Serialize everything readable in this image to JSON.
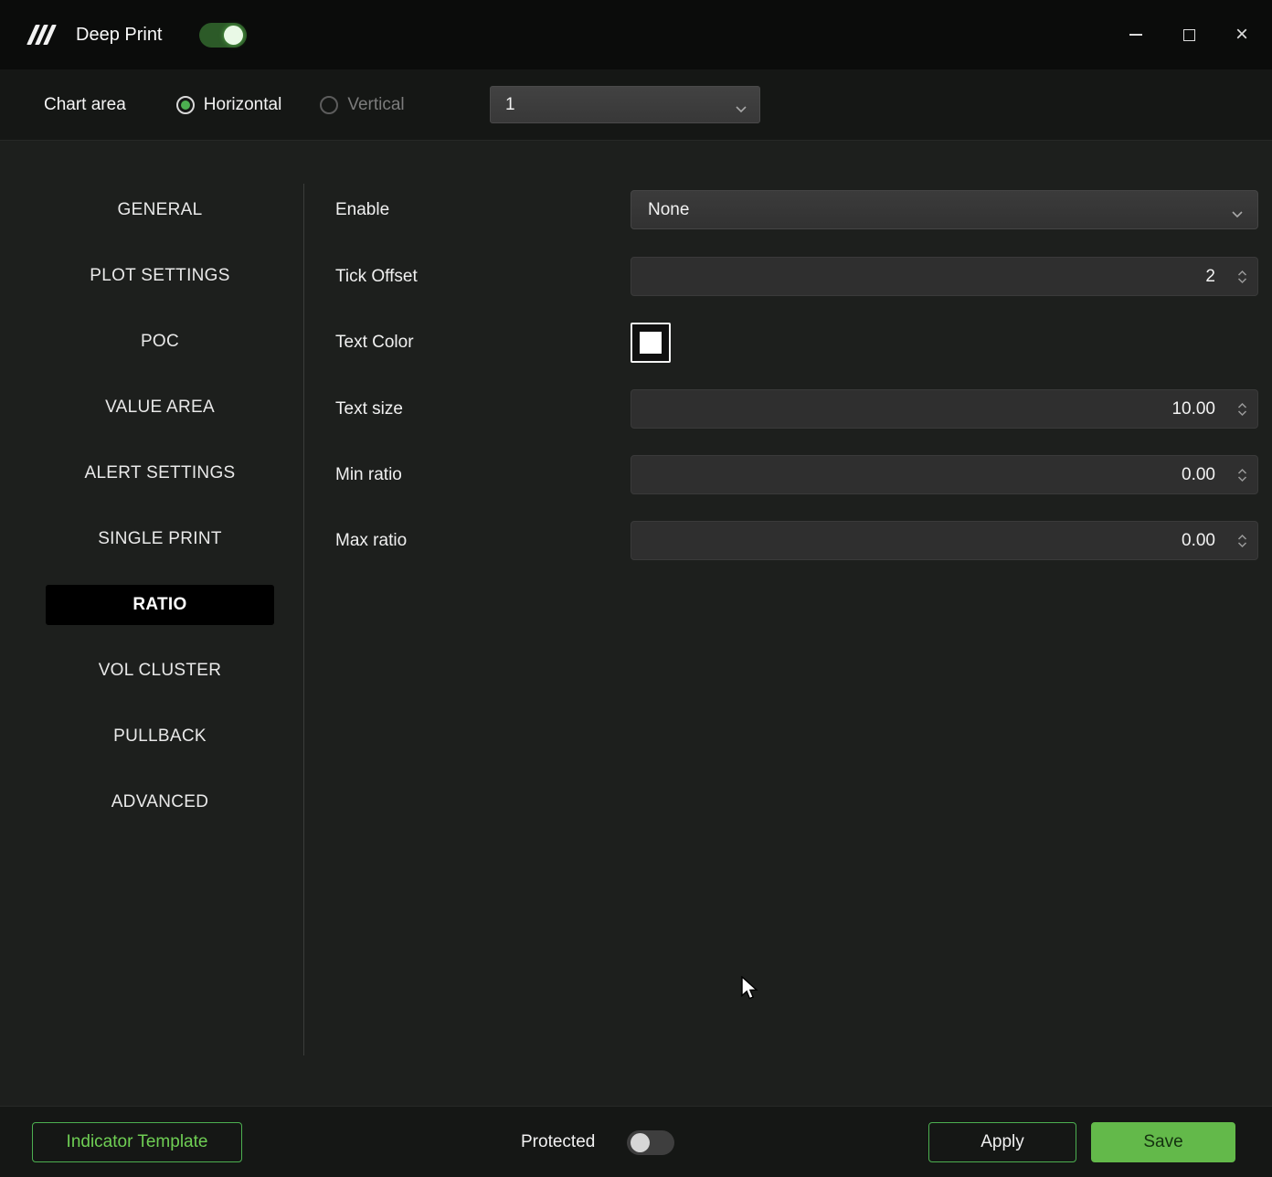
{
  "titlebar": {
    "title": "Deep Print",
    "main_toggle_on": true,
    "icons": {
      "logo": "logo-icon (three slashes)",
      "minimize": "minimize-icon",
      "maximize": "maximize-icon",
      "close": "close-icon"
    }
  },
  "chart_area": {
    "label": "Chart area",
    "options": [
      {
        "label": "Horizontal",
        "selected": true
      },
      {
        "label": "Vertical",
        "selected": false
      }
    ],
    "dropdown_value": "1"
  },
  "sidebar": {
    "items": [
      {
        "label": "GENERAL",
        "selected": false
      },
      {
        "label": "PLOT SETTINGS",
        "selected": false
      },
      {
        "label": "POC",
        "selected": false
      },
      {
        "label": "VALUE AREA",
        "selected": false
      },
      {
        "label": "ALERT SETTINGS",
        "selected": false
      },
      {
        "label": "SINGLE PRINT",
        "selected": false
      },
      {
        "label": "RATIO",
        "selected": true
      },
      {
        "label": "VOL CLUSTER",
        "selected": false
      },
      {
        "label": "PULLBACK",
        "selected": false
      },
      {
        "label": "ADVANCED",
        "selected": false
      }
    ]
  },
  "form": {
    "fields": [
      {
        "label": "Enable",
        "type": "select",
        "value": "None"
      },
      {
        "label": "Tick Offset",
        "type": "number",
        "value": "2"
      },
      {
        "label": "Text Color",
        "type": "color",
        "value": "#ffffff"
      },
      {
        "label": "Text size",
        "type": "number",
        "value": "10.00"
      },
      {
        "label": "Min ratio",
        "type": "number",
        "value": "0.00"
      },
      {
        "label": "Max ratio",
        "type": "number",
        "value": "0.00"
      }
    ]
  },
  "footer": {
    "indicator_template_label": "Indicator Template",
    "protected_label": "Protected",
    "protected_on": false,
    "apply_label": "Apply",
    "save_label": "Save"
  },
  "colors": {
    "accent_green": "#4caf50",
    "save_button_green": "#63b94a",
    "background": "#1d1f1d",
    "titlebar": "#0b0c0b",
    "input_background": "#2f2f2f",
    "selected_tab_background": "#000000",
    "text_color_swatch": "#ffffff"
  }
}
